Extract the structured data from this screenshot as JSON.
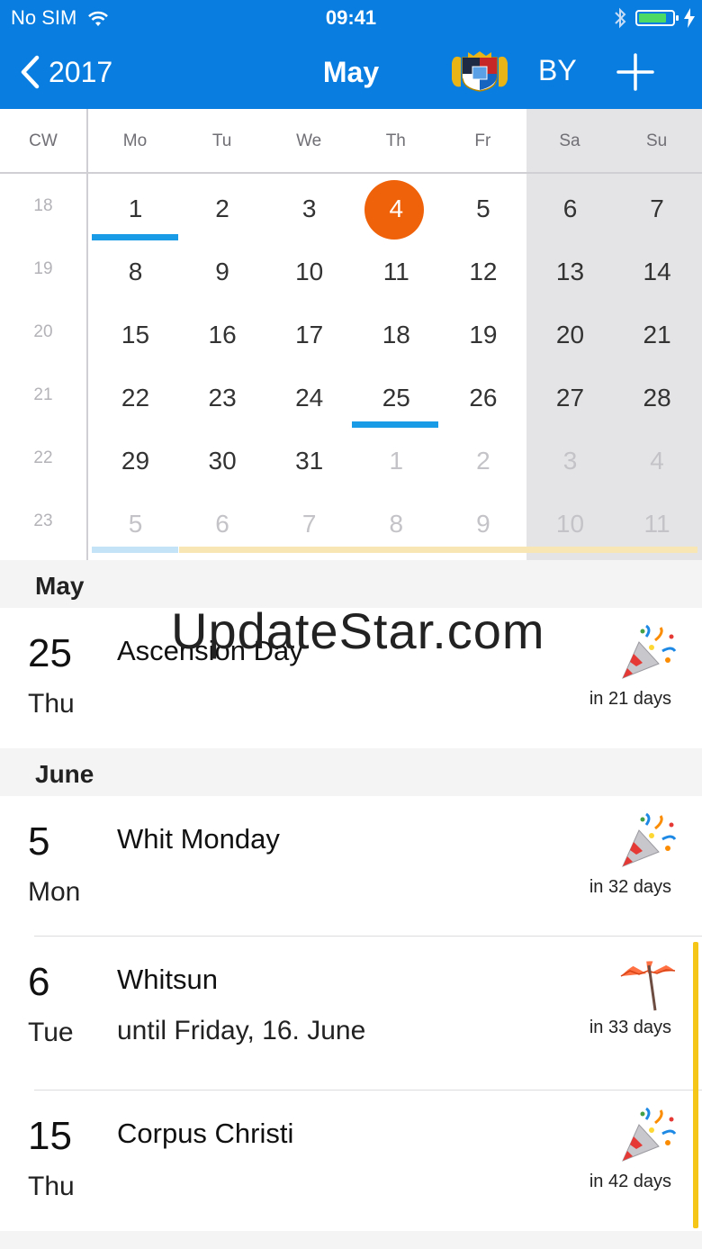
{
  "status_bar": {
    "carrier": "No SIM",
    "time": "09:41"
  },
  "nav": {
    "back_label": "2017",
    "title": "May",
    "region": "BY"
  },
  "calendar": {
    "cw_label": "CW",
    "weekdays": [
      "Mo",
      "Tu",
      "We",
      "Th",
      "Fr",
      "Sa",
      "Su"
    ],
    "week_numbers": [
      "18",
      "19",
      "20",
      "21",
      "22",
      "23"
    ],
    "weeks": [
      [
        "1",
        "2",
        "3",
        "4",
        "5",
        "6",
        "7"
      ],
      [
        "8",
        "9",
        "10",
        "11",
        "12",
        "13",
        "14"
      ],
      [
        "15",
        "16",
        "17",
        "18",
        "19",
        "20",
        "21"
      ],
      [
        "22",
        "23",
        "24",
        "25",
        "26",
        "27",
        "28"
      ],
      [
        "29",
        "30",
        "31",
        "1",
        "2",
        "3",
        "4"
      ],
      [
        "5",
        "6",
        "7",
        "8",
        "9",
        "10",
        "11"
      ]
    ],
    "today": "4",
    "colors": {
      "header": "#0a7ee0",
      "today": "#f0620a",
      "holiday_marker": "#1a9be6",
      "vacation_marker": "#f8e7b4",
      "weekend_bg": "#e4e4e6"
    }
  },
  "sections": [
    {
      "month": "May",
      "events": [
        {
          "day": "25",
          "weekday": "Thu",
          "title": "Ascension Day",
          "subtitle": "",
          "countdown": "in 21 days",
          "icon": "party-popper-icon"
        }
      ]
    },
    {
      "month": "June",
      "events": [
        {
          "day": "5",
          "weekday": "Mon",
          "title": "Whit Monday",
          "subtitle": "",
          "countdown": "in 32 days",
          "icon": "party-popper-icon"
        },
        {
          "day": "6",
          "weekday": "Tue",
          "title": "Whitsun",
          "subtitle": "until Friday, 16. June",
          "countdown": "in 33 days",
          "icon": "beach-umbrella-icon"
        },
        {
          "day": "15",
          "weekday": "Thu",
          "title": "Corpus Christi",
          "subtitle": "",
          "countdown": "in 42 days",
          "icon": "party-popper-icon"
        }
      ]
    }
  ],
  "watermark": "UpdateStar.com"
}
